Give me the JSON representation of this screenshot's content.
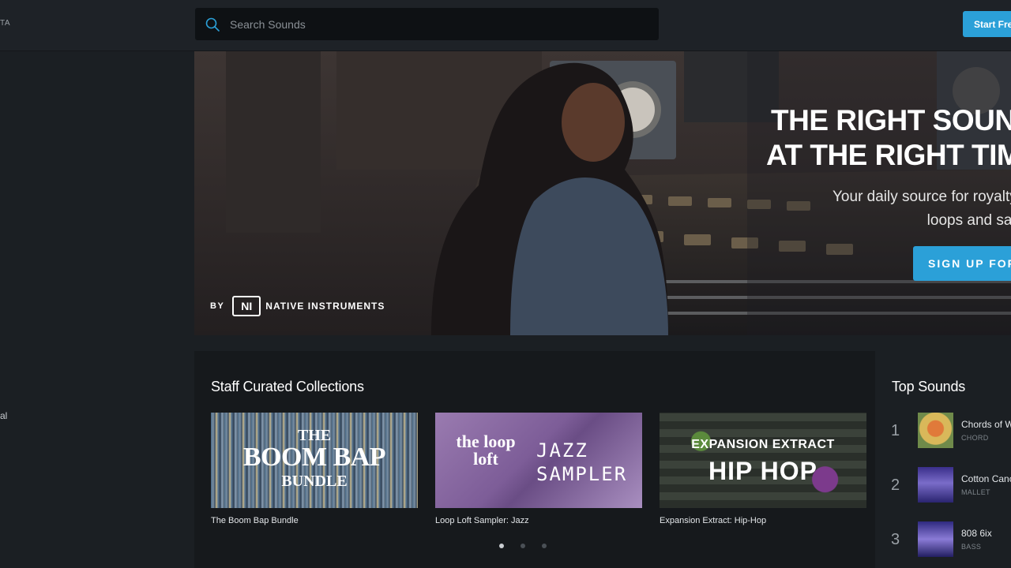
{
  "header": {
    "brand_fragment": "TA",
    "search": {
      "placeholder": "Search Sounds"
    },
    "start_button": "Start Free"
  },
  "sidebar": {
    "item_fragment": "al"
  },
  "hero": {
    "headline_line1": "THE RIGHT SOUN",
    "headline_line2": "AT THE RIGHT TIM",
    "sub_line1": "Your daily source for royalty",
    "sub_line2": "loops and sar",
    "cta": "SIGN UP FOR",
    "logo_by": "BY",
    "logo_mark": "NI",
    "logo_name": "NATIVE INSTRUMENTS"
  },
  "collections": {
    "title": "Staff Curated Collections",
    "items": [
      {
        "caption": "The Boom Bap Bundle",
        "art_line1": "THE",
        "art_line2": "BOOM BAP",
        "art_line3": "BUNDLE"
      },
      {
        "caption": "Loop Loft Sampler: Jazz",
        "art_brand": "the loop loft",
        "art_line1": "JAZZ",
        "art_line2": "SAMPLER"
      },
      {
        "caption": "Expansion Extract: Hip-Hop",
        "art_line1": "EXPANSION EXTRACT",
        "art_line2": "HIP HOP"
      }
    ],
    "pager": {
      "pages": 3,
      "active": 1
    }
  },
  "top_sounds": {
    "title": "Top Sounds",
    "items": [
      {
        "rank": "1",
        "title": "Chords of W",
        "type": "CHORD"
      },
      {
        "rank": "2",
        "title": "Cotton Canc",
        "type": "MALLET"
      },
      {
        "rank": "3",
        "title": "808 6ix",
        "type": "BASS"
      }
    ]
  },
  "colors": {
    "accent": "#2ba0d8",
    "background": "#1b1f23",
    "panel": "#16191c",
    "search_bg": "#0e1114"
  }
}
